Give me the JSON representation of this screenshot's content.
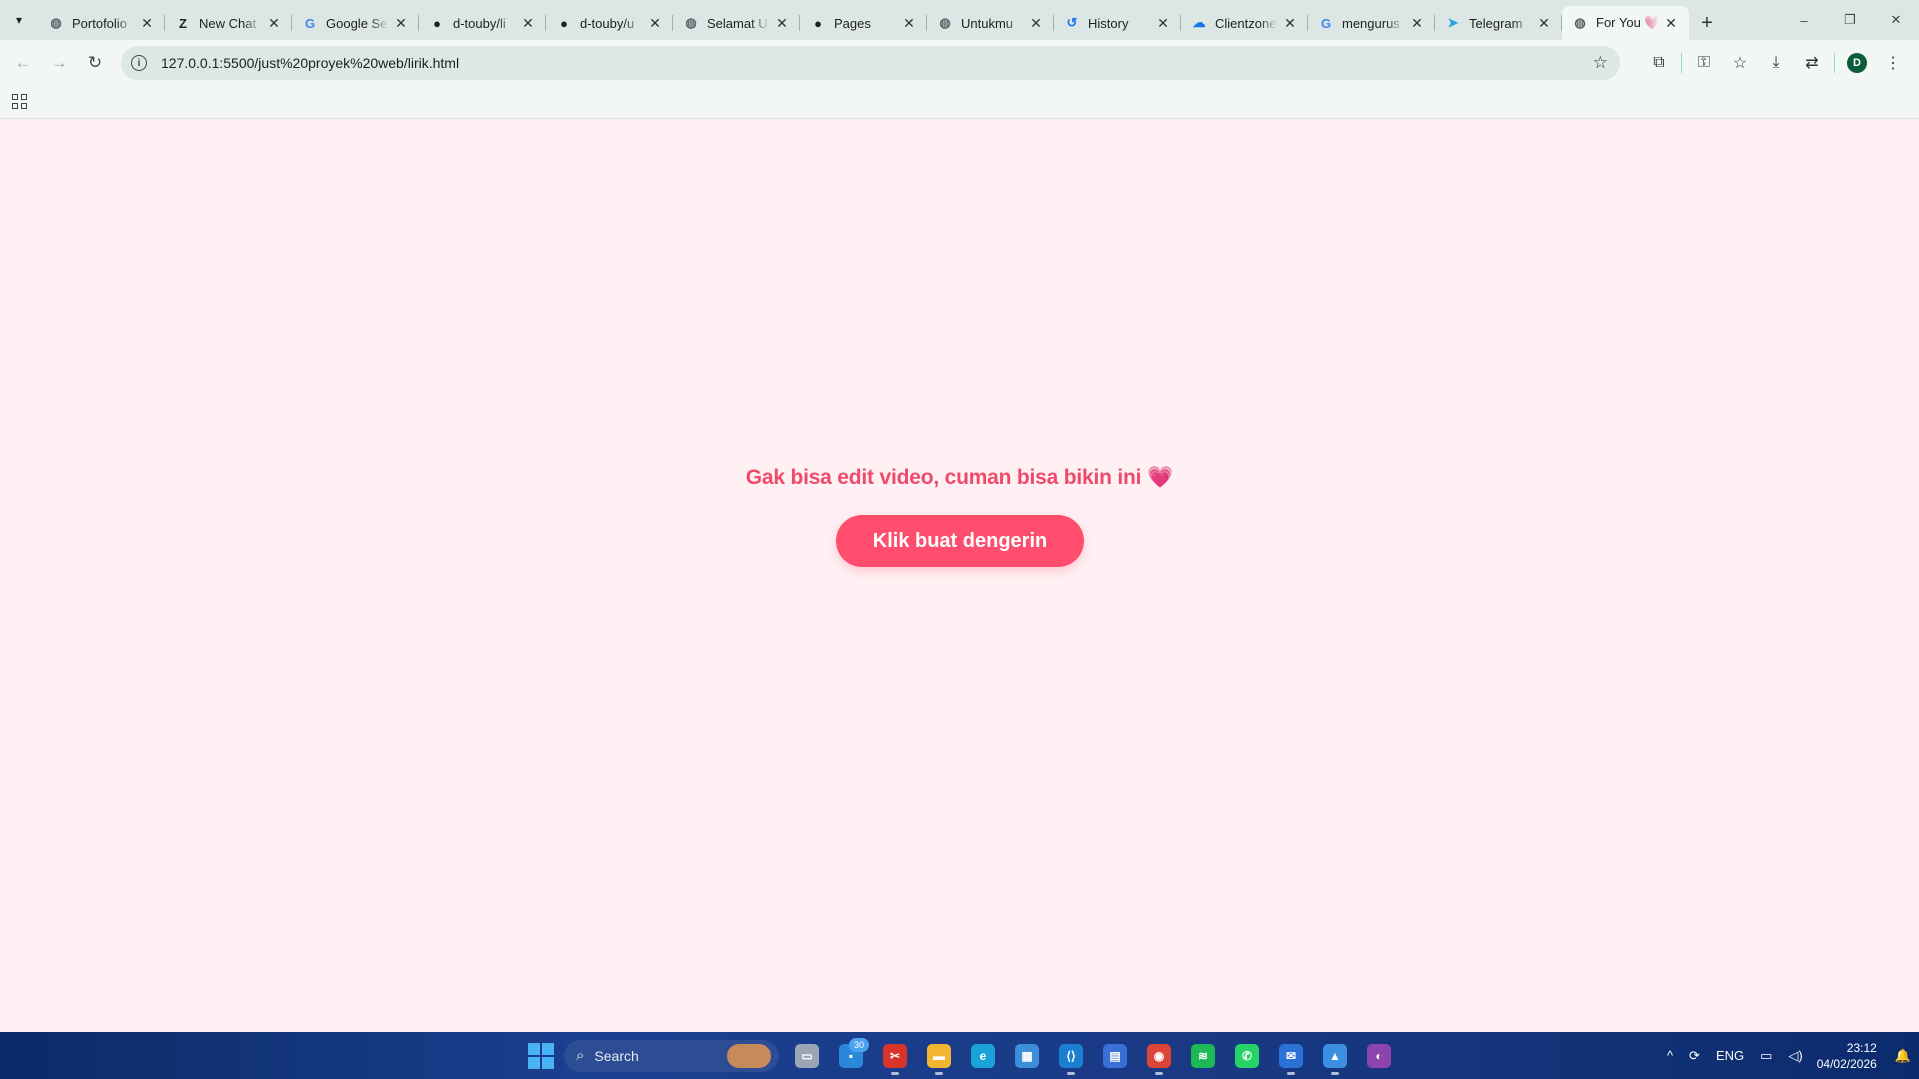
{
  "browser": {
    "tab_search_icon": "chevron-down-icon",
    "tabs": [
      {
        "title": "Portofolio",
        "favicon": "globe",
        "color": "#5f6368",
        "active": false
      },
      {
        "title": "New Chat",
        "favicon": "z",
        "color": "#1f1f1f",
        "active": false
      },
      {
        "title": "Google Se",
        "favicon": "G",
        "color": "#4285f4",
        "active": false
      },
      {
        "title": "d-touby/li",
        "favicon": "github",
        "color": "#1f1f1f",
        "active": false
      },
      {
        "title": "d-touby/u",
        "favicon": "github",
        "color": "#1f1f1f",
        "active": false
      },
      {
        "title": "Selamat U",
        "favicon": "globe",
        "color": "#5f6368",
        "active": false
      },
      {
        "title": "Pages",
        "favicon": "github",
        "color": "#1f1f1f",
        "active": false
      },
      {
        "title": "Untukmu",
        "favicon": "globe",
        "color": "#5f6368",
        "active": false
      },
      {
        "title": "History",
        "favicon": "history",
        "color": "#1a73e8",
        "active": false
      },
      {
        "title": "Clientzone",
        "favicon": "cloud",
        "color": "#1a73e8",
        "active": false
      },
      {
        "title": "mengurus",
        "favicon": "G",
        "color": "#4285f4",
        "active": false
      },
      {
        "title": "Telegram",
        "favicon": "telegram",
        "color": "#2aa3df",
        "active": false
      },
      {
        "title": "For You 💗",
        "favicon": "globe",
        "color": "#5f6368",
        "active": true
      }
    ],
    "tab_close_symbol": "✕",
    "new_tab_symbol": "+",
    "window_controls": {
      "minimize": "–",
      "restore": "❐",
      "close": "✕"
    },
    "toolbar": {
      "back": "←",
      "forward": "→",
      "reload": "↻",
      "url": "127.0.0.1:5500/just%20proyek%20web/lirik.html",
      "bookmark_star": "☆",
      "right_icons": [
        "⧉",
        "⚿",
        "☆",
        "⤓",
        "⇄"
      ],
      "profile_initial": "D"
    },
    "bookmarks_bar": {
      "apps_icon": "apps-grid-icon"
    }
  },
  "page": {
    "background": "#fff0f3",
    "headline": "Gak bisa edit video, cuman bisa bikin ini",
    "headline_emoji": "💗",
    "headline_color": "#ee4b6a",
    "button_label": "Klik buat dengerin",
    "button_color": "#ff4d6d"
  },
  "taskbar": {
    "search_label": "Search",
    "apps": [
      {
        "name": "task-view",
        "color": "#9aa5b5",
        "glyph": "▭"
      },
      {
        "name": "widgets",
        "color": "#2b88d8",
        "glyph": "▪",
        "badge": "30"
      },
      {
        "name": "snipping-tool",
        "color": "#d9342b",
        "glyph": "✂",
        "running": true
      },
      {
        "name": "file-explorer",
        "color": "#f2b630",
        "glyph": "▬",
        "running": true
      },
      {
        "name": "edge",
        "color": "#1aa3d9",
        "glyph": "e"
      },
      {
        "name": "photos",
        "color": "#3c8ed8",
        "glyph": "▦"
      },
      {
        "name": "vscode",
        "color": "#1a7fd0",
        "glyph": "⟨⟩",
        "running": true
      },
      {
        "name": "store",
        "color": "#3a6fd6",
        "glyph": "▤"
      },
      {
        "name": "chrome",
        "color": "#db4437",
        "glyph": "◉",
        "running": true
      },
      {
        "name": "spotify",
        "color": "#1db954",
        "glyph": "≋"
      },
      {
        "name": "whatsapp",
        "color": "#25d366",
        "glyph": "✆"
      },
      {
        "name": "outlook",
        "color": "#2a72d8",
        "glyph": "✉",
        "running": true
      },
      {
        "name": "gallery",
        "color": "#3a8fe0",
        "glyph": "▲",
        "running": true
      },
      {
        "name": "github-desktop",
        "color": "#8e44ad",
        "glyph": "◐"
      }
    ],
    "tray": {
      "chevron": "^",
      "sync": "⟳",
      "language": "ENG",
      "network": "▭",
      "volume": "◁)",
      "time": "23:12",
      "date": "04/02/2026",
      "notifications": "🔔"
    }
  }
}
